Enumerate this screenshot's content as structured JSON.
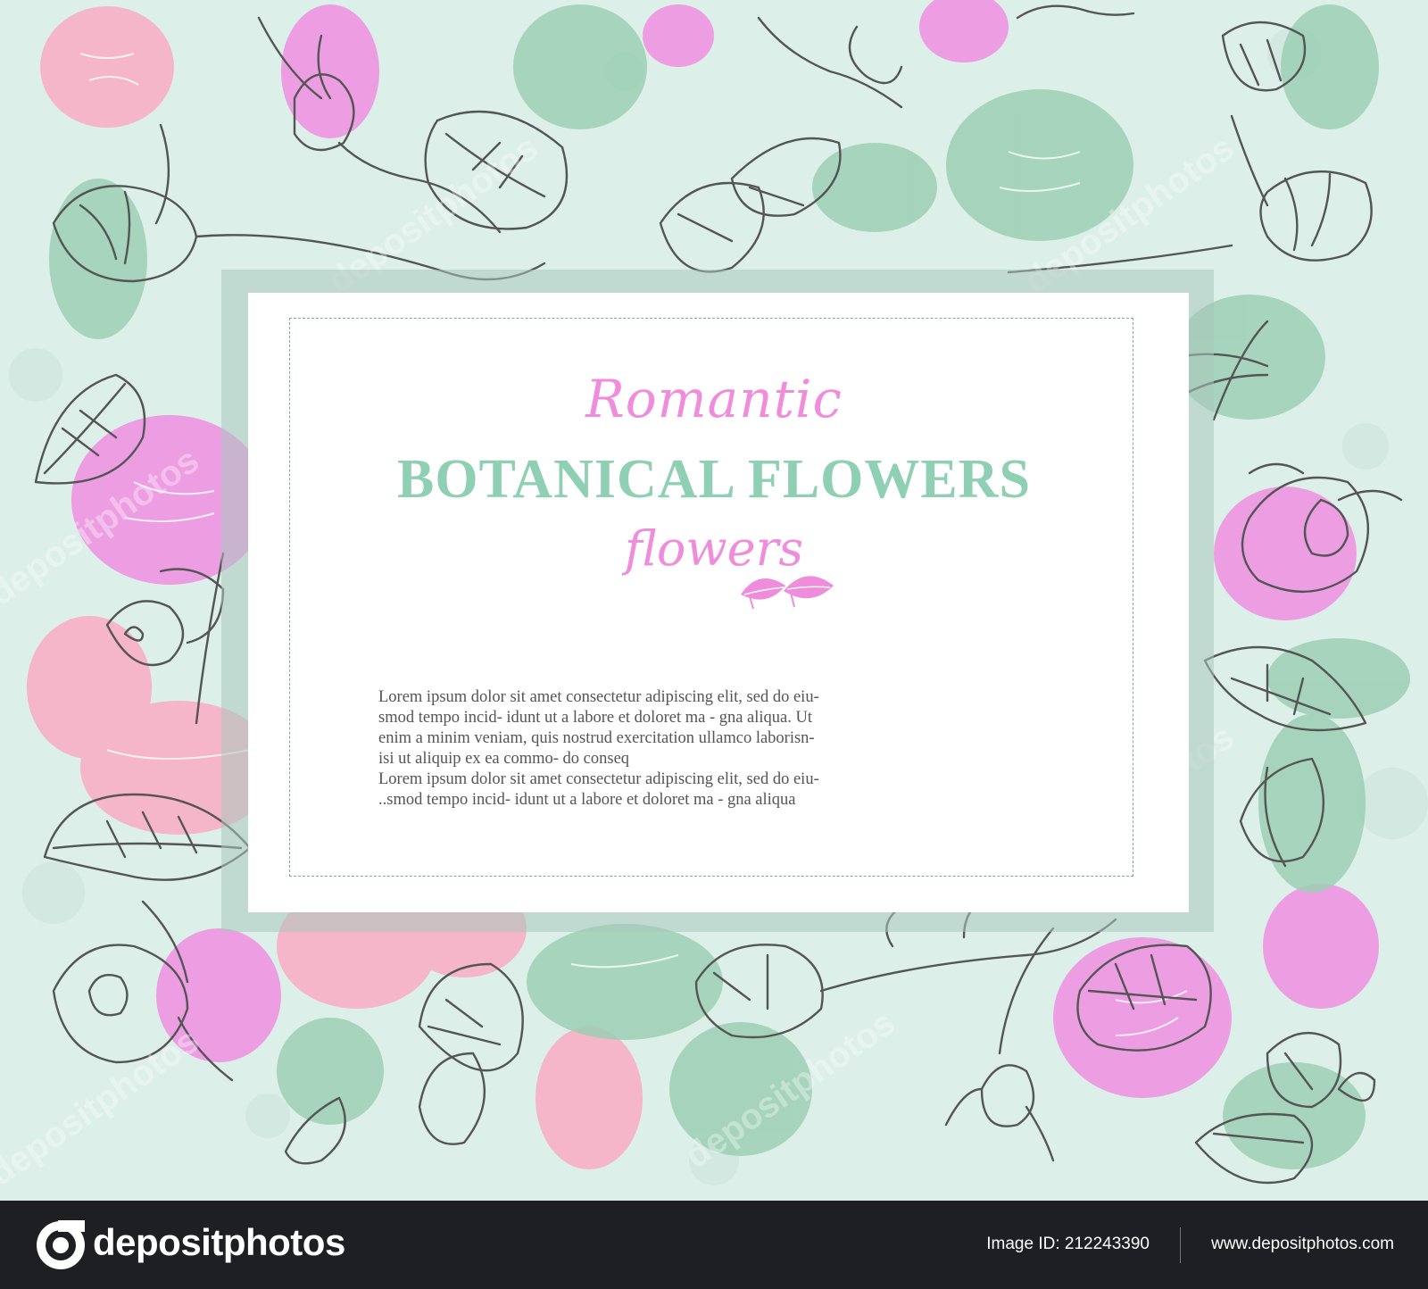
{
  "card": {
    "kicker": "Romantic",
    "headline": "BOTANICAL FLOWERS",
    "tagline": "flowers",
    "body_lines": [
      "Lorem ipsum dolor sit amet consectetur adipiscing elit, sed do eiu-",
      "smod tempo incid- idunt  ut a labore et doloret ma - gna aliqua. Ut",
      "enim a minim veniam, quis nostrud exercitation ullamco laborisn-",
      "isi ut aliquip ex ea commo- do conseq",
      "Lorem ipsum dolor sit amet consectetur adipiscing elit, sed do eiu-",
      "..smod tempo incid- idunt  ut a labore et doloret ma - gna aliqua"
    ]
  },
  "footer": {
    "logo_text": "depositphotos",
    "image_id_label": "Image ID:",
    "image_id": "212243390",
    "site_url": "www.depositphotos.com"
  },
  "colors": {
    "background_mint": "#dcefe8",
    "rose_pink": "#f4b6c8",
    "magenta_pink": "#f08fe0",
    "leaf_green": "#9ccfb4",
    "outline_gray": "#555555",
    "footer_bg": "#1e1f23"
  },
  "icons": [
    "rose-bud-icon",
    "leaf-icon",
    "depositphotos-logo-icon"
  ]
}
